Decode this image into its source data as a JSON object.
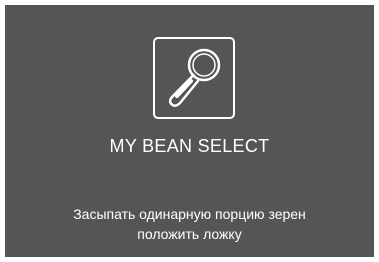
{
  "screen": {
    "background_color": "#555555",
    "text_color": "#ffffff",
    "icon": "measuring-spoon-icon",
    "title": "MY BEAN SELECT",
    "message_lines": [
      "Засыпать одинарную порцию зерен",
      "положить ложку"
    ]
  }
}
